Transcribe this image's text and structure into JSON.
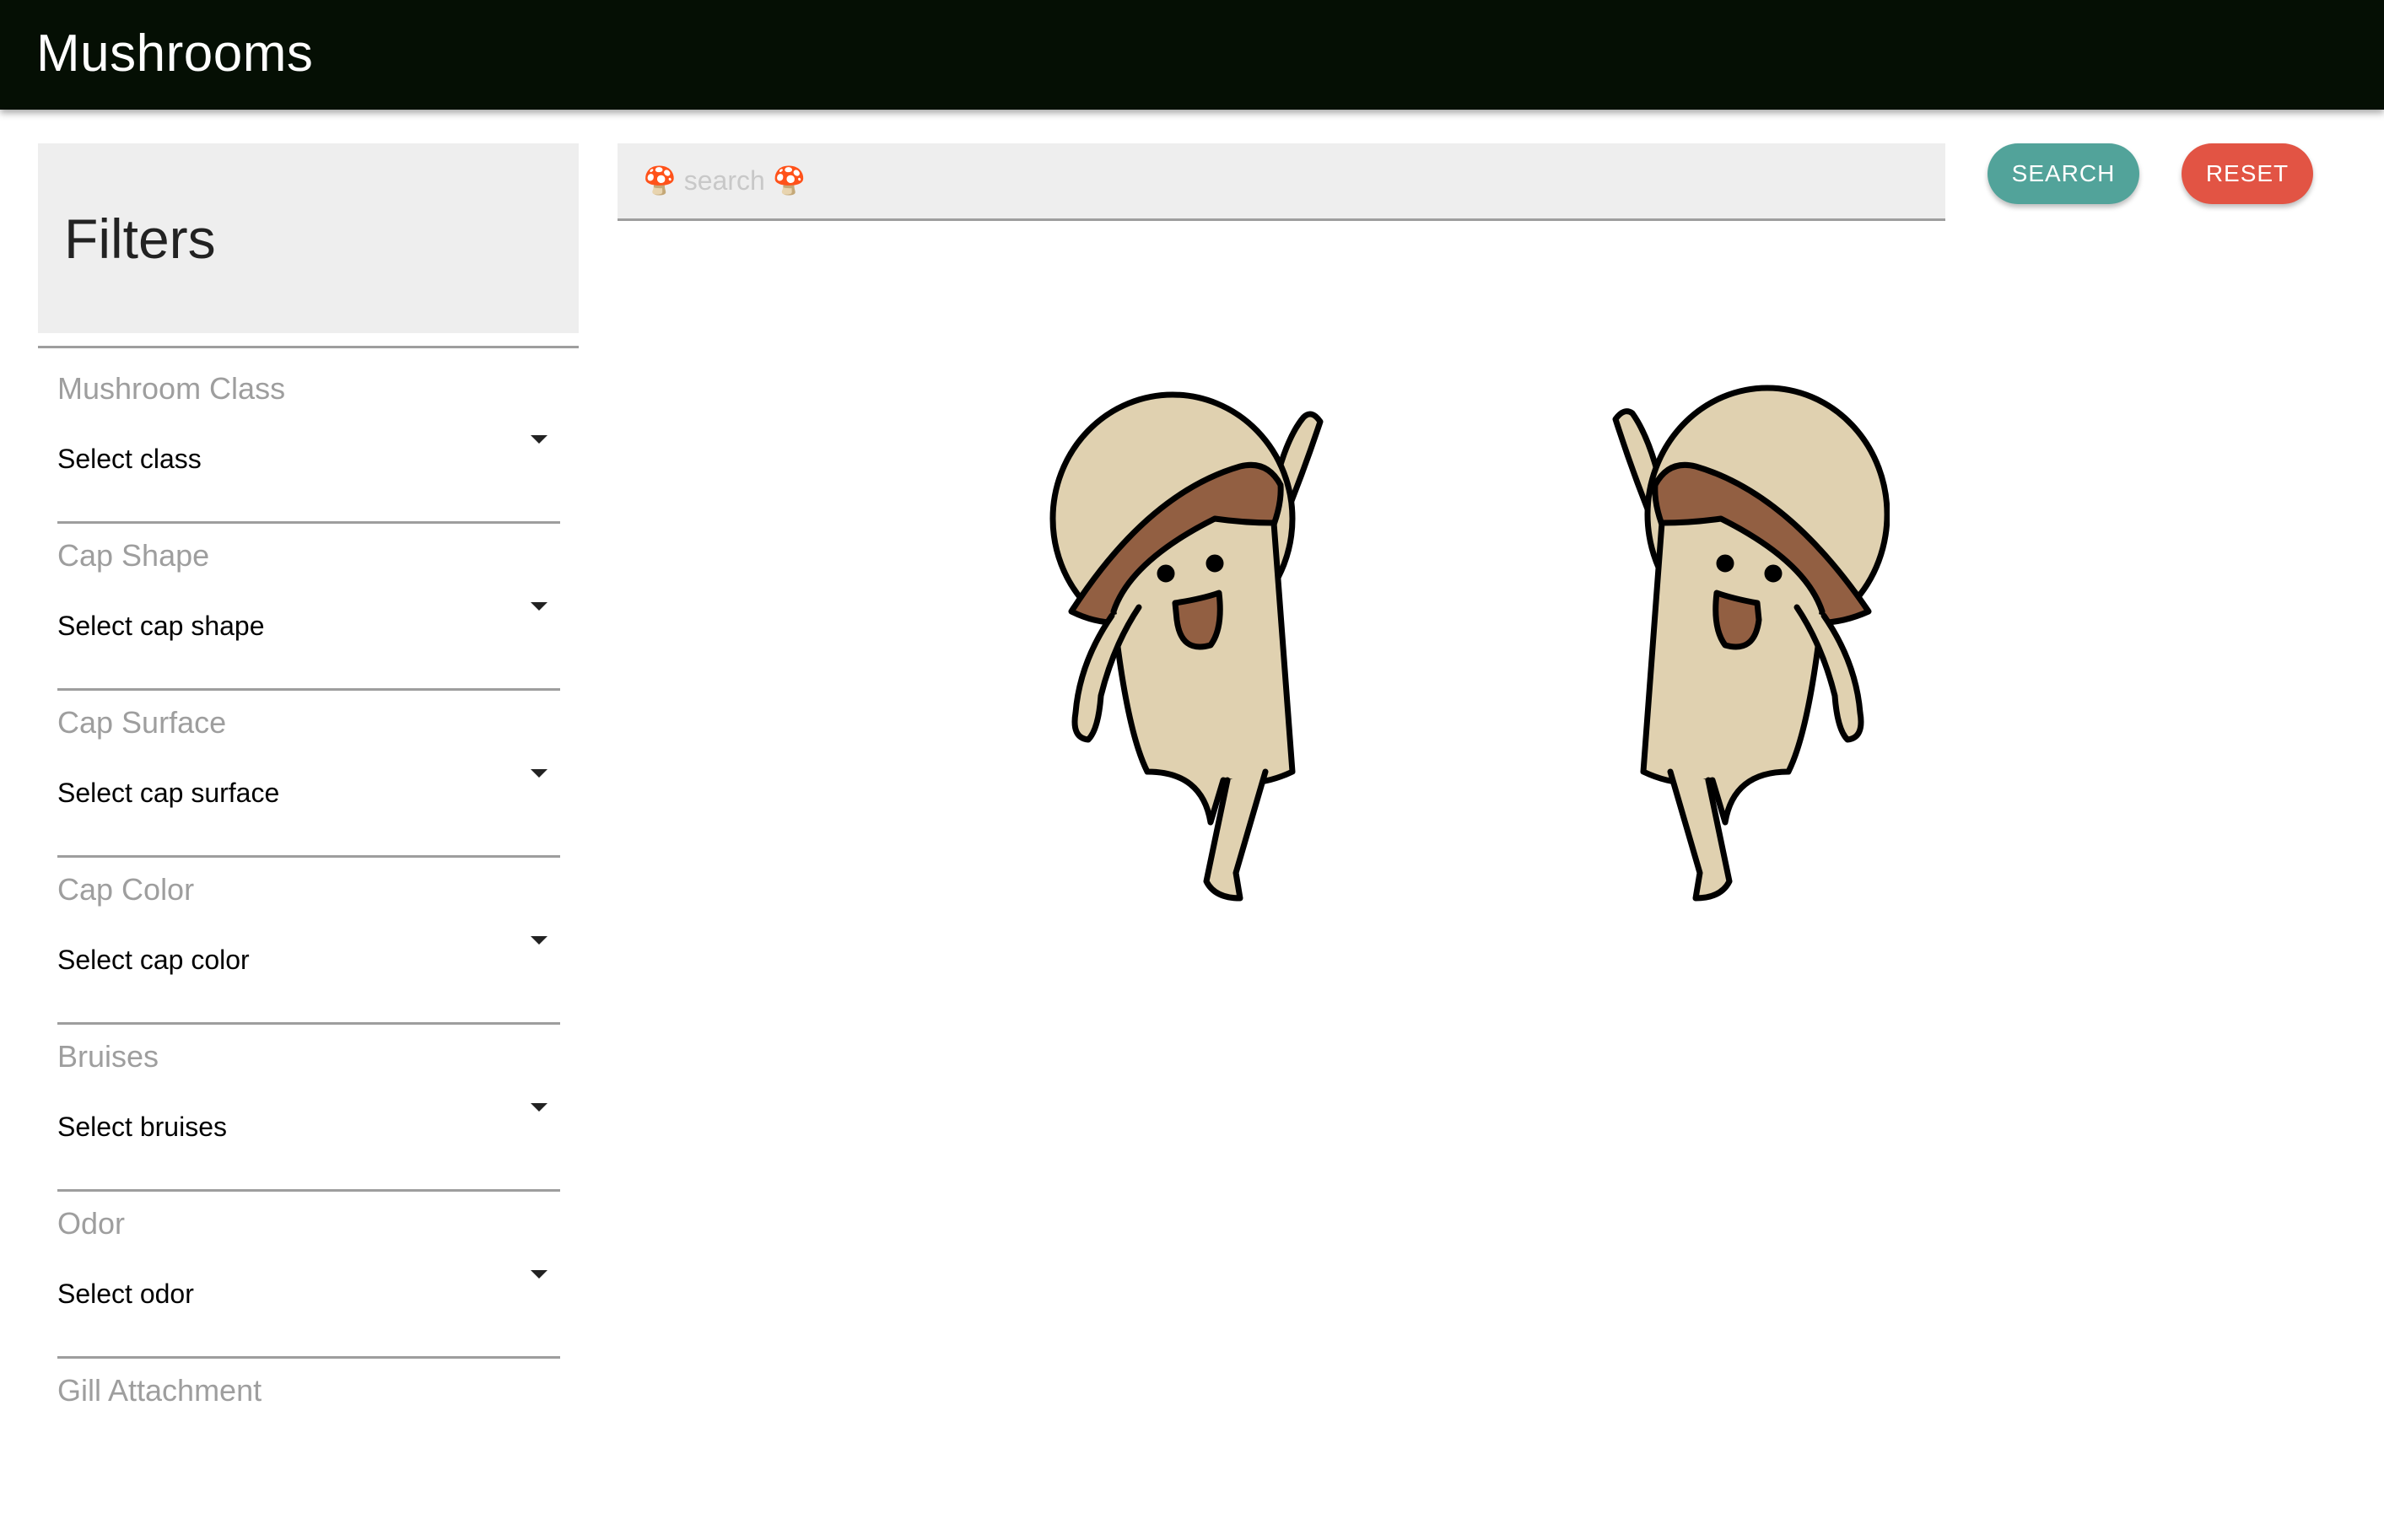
{
  "app_bar": {
    "title": "Mushrooms"
  },
  "filters": {
    "title": "Filters",
    "fields": [
      {
        "label": "Mushroom Class",
        "value": "Select class"
      },
      {
        "label": "Cap Shape",
        "value": "Select cap shape"
      },
      {
        "label": "Cap Surface",
        "value": "Select cap surface"
      },
      {
        "label": "Cap Color",
        "value": "Select cap color"
      },
      {
        "label": "Bruises",
        "value": "Select bruises"
      },
      {
        "label": "Odor",
        "value": "Select odor"
      },
      {
        "label": "Gill Attachment",
        "value": ""
      }
    ]
  },
  "search": {
    "placeholder": "🍄 search 🍄",
    "value": ""
  },
  "buttons": {
    "search_label": "SEARCH",
    "reset_label": "RESET"
  },
  "hero": {
    "icon": "mushrooms-high-five-illustration"
  },
  "colors": {
    "app_bar": "#050f04",
    "search_button": "#52a39a",
    "reset_button": "#e25444",
    "mushroom_cap": "#e0d1b0",
    "mushroom_gills": "#925f42"
  }
}
